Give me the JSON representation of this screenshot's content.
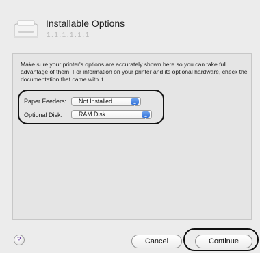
{
  "header": {
    "title": "Installable Options",
    "subtitle": "1.1.1.1.1.1",
    "printer_icon": "printer-icon"
  },
  "info_text": "Make sure your printer's options are accurately shown here so you can take full advantage of them.  For information on your printer and its optional hardware, check the documentation that came with it.",
  "options": {
    "paper_feeders": {
      "label": "Paper Feeders:",
      "value": "Not Installed"
    },
    "optional_disk": {
      "label": "Optional Disk:",
      "value": "RAM Disk"
    }
  },
  "footer": {
    "help_label": "?",
    "cancel_label": "Cancel",
    "continue_label": "Continue"
  },
  "colors": {
    "popup_arrow_blue": "#2e6fd8",
    "help_purple": "#6b3fa0",
    "annotation_ring": "#111111"
  }
}
